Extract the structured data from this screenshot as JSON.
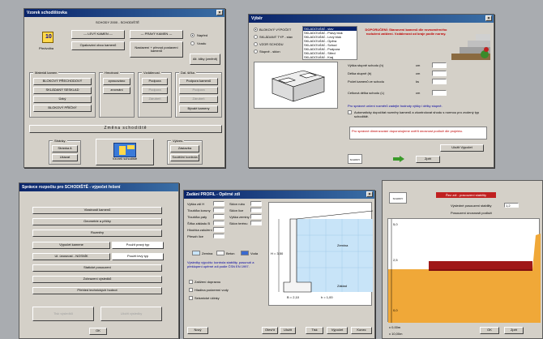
{
  "window_main": {
    "title": "Vzorek schodištovka",
    "header_text": "SCHODY 2000 - SCHODIŠTĚ",
    "left_icon_label": "Předvolba",
    "top_btn1": "--- LEVÝ KAMEN ---",
    "top_btn1_sub": "Opakování obou kamenů",
    "top_btn2": "--- PRAVÝ KAMEN ---",
    "top_btn2_sub": "Nastavení + převod postavení kamenů",
    "radio1": "Napřed",
    "radio2": "Vzadu",
    "right_btn": "Alt. kliky (změnit)",
    "grp1": "Materiál kamen",
    "grp1_items": [
      "BLOKOVÝ PŘECHODOVÝ",
      "SKLÁDANÝ SESKLAD",
      "Úzký",
      "BLOKOVÝ PŘÍČNÝ"
    ],
    "grp2": "Hmotnost",
    "grp2_items": [
      "zpracováno",
      "zrovnání"
    ],
    "grp3": "Vzdálenost",
    "grp3_items": [
      "Podpora",
      "Podpora",
      "Zárubeň"
    ],
    "grp4": "Dal. šířka",
    "grp4_items": [
      "Podpora kamenů",
      "Podpora",
      "Zárubeň",
      "Bývalé kameny"
    ],
    "bar_label": "Změna schodiště",
    "bottom_left_grp": "Stránky",
    "bottom_left_btns": [
      "Stránka A",
      "Ukázat"
    ],
    "bottom_center_label": "Vzorek schodiště",
    "bottom_right_grp": "Výkres",
    "bottom_right_btns": [
      "Zástavba",
      "Soutěžní kontrola"
    ]
  },
  "window_detail": {
    "title": "Výběr",
    "radios": [
      "BLOKOVÝ VÝPOČET",
      "SKLÁDANÝ TYP - stav",
      "VZOR SCHODU",
      "Stupně - sklon"
    ],
    "list_items": [
      "SKLADOVÁNÍ - stav",
      "SKLADOVÁNÍ - Pravý blok",
      "SKLADOVÁNÍ - Levý blok",
      "SKLADOVÁNÍ - Opěra",
      "SKLADOVÁNÍ - Schod",
      "SKLADOVÁNÍ - Podpora",
      "SKLADOVÁNÍ - Střed",
      "SKLADOVÁNÍ - Kraj"
    ],
    "red_note": "DOPORUČENÍ: Stanovení kamenů dle rovnoměrného rozložení zatížení. Vzdálenost od kraje podle normy.",
    "field_labels": [
      "Výška stupně schodu (h)",
      "Délka stupně (b)",
      "Počet kamenů ve schodu",
      "Celková délka schodu (L)"
    ],
    "field_units": [
      "cm",
      "cm",
      "ks",
      "cm"
    ],
    "blue_note": "Pro správné určení rozměrů zadejte hodnoty výšky i délky stupně.",
    "check_note": "Automaticky dopočítat rozměry kamenů a zkontrolovat shodu s normou pro zvolený typ schodiště.",
    "info_box": "Pro správné dimenzování doporučujeme ověřit únosnost podloží dle projektu.",
    "btn_calc": "Uložit Výpočet",
    "btn_back": "Zpět",
    "logo": "SCHODY"
  },
  "window_menu": {
    "title": "Správce rozpočtu pro SCHODIŠTĚ - výpočet řešení",
    "btns": [
      "Vlastnosti kamenů",
      "Geometrie a příčky",
      "Rozměry",
      "Výpočet zatížení",
      "Přehled únosnosti",
      "Statické posouzení",
      "Zobrazení výsledků",
      "Přehled technických hodnot"
    ],
    "side_btn1": "Použít pravý typ",
    "side_btn2": "Použít levý typ",
    "row4_label": "Výpočet kamene",
    "row5_label": "Ul. únosnost - NOSNÍK",
    "disabled": [
      "Tisk výsledků",
      "Uložit výsledky"
    ],
    "ok": "OK"
  },
  "window_section": {
    "title": "Zadání PROFIL - Opěrné zdi",
    "left_fields": [
      "Výška zdi H",
      "Tloušťka koruny",
      "Tloušťka paty",
      "Šířka základu B",
      "Hloubka založení",
      "Přesah líce"
    ],
    "right_fields": [
      "Sklon rubu",
      "Sklon líce",
      "Výška zeminy",
      "Sklon terénu"
    ],
    "legend": [
      "Zemina",
      "Beton",
      "Voda"
    ],
    "blue_lines": "Výsledky výpočtu: kontrola stability, posunutí a překlopení opěrné zdi podle ČSN EN 1997.",
    "checks": [
      "Zatížení dopravou",
      "Hladina podzemní vody",
      "Seismické účinky"
    ],
    "bottom_btns": [
      "Nový",
      "Otevřít",
      "Uložit",
      "Tisk",
      "Výpočet",
      "Konec"
    ],
    "dims": [
      "H = 3,50",
      "B = 2,10",
      "h = 1,00"
    ],
    "label_soil": "Zemina",
    "label_found": "Základ"
  },
  "window_chart": {
    "title": "Řez zdí - posouzení stability",
    "logo": "SCHODY",
    "label1": "Výsledné posouzení stability",
    "value1": "1,2",
    "label2": "Posouzení únosnosti podloží",
    "y_labels": [
      "5,0",
      "2,5",
      "0,0"
    ],
    "btn_ok": "OK",
    "btn_cancel": "Zpět",
    "bottom_labels": [
      "x 0,00m",
      "x 10,00m"
    ]
  }
}
